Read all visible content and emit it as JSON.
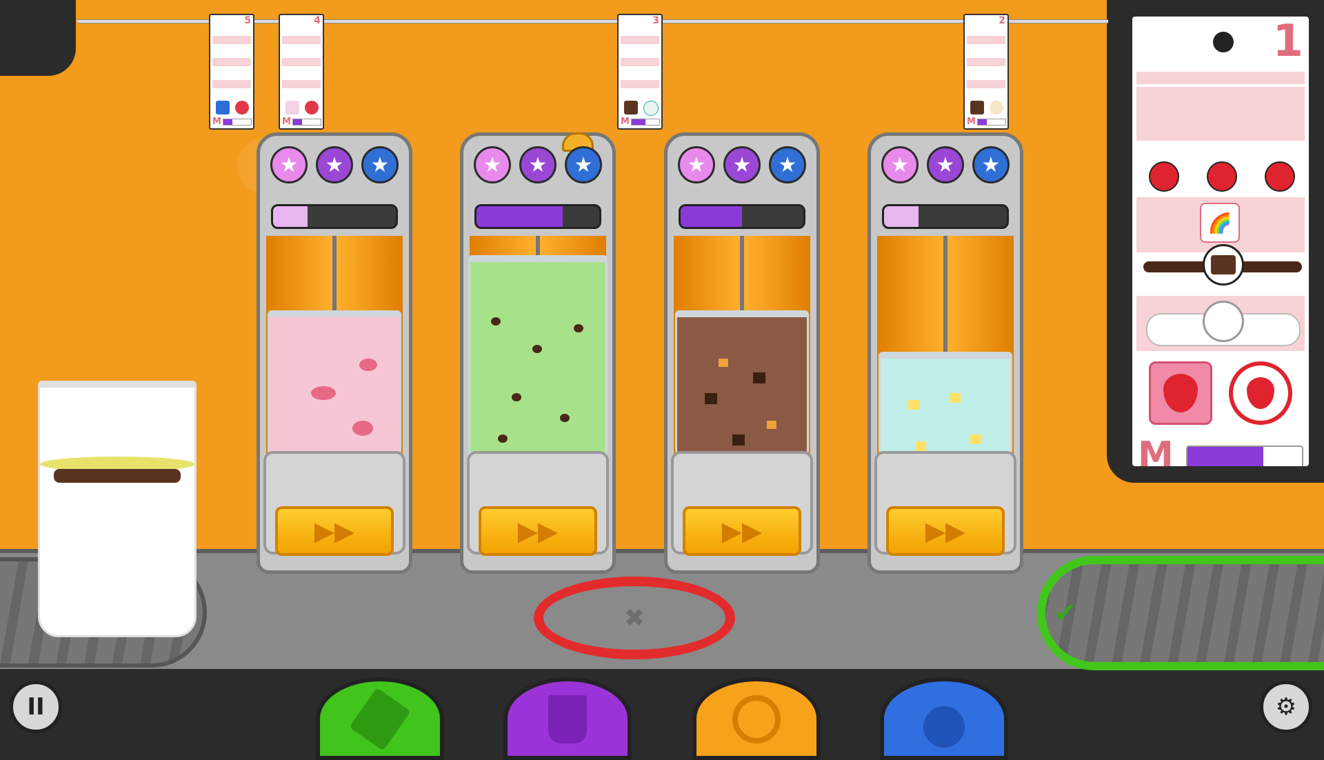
{
  "game": "blender-station",
  "colors": {
    "background": "#f39b1c",
    "counter": "#7f7f7f",
    "accept_green": "#42c61b",
    "reject_red": "#e22c2c",
    "star_pink": "#e889ec",
    "star_purple": "#9a47d6",
    "star_blue": "#2f6fd6"
  },
  "hanging_tickets": [
    {
      "number": "5",
      "size": "M",
      "size_level": 0.33
    },
    {
      "number": "4",
      "size": "M",
      "size_level": 0.33
    },
    {
      "number": "3",
      "size": "M",
      "size_level": 0.5
    },
    {
      "number": "2",
      "size": "M",
      "size_level": 0.33
    }
  ],
  "active_ticket": {
    "number": "1",
    "toppings": [
      "cherry-icon",
      "cherry-icon",
      "cherry-icon"
    ],
    "sprinkles": "rainbow-sprinkles-icon",
    "drizzle": "chocolate-drizzle-icon",
    "whipped": "whipped-cream-icon",
    "mixables": [
      "strawberry-icon",
      "strawberry-slice-icon"
    ],
    "size": "M",
    "size_level": 0.66
  },
  "blenders": [
    {
      "stars_lit": 0,
      "gauge_level": 0.28,
      "gauge_color": "#e7b6ef",
      "drink_color": "#f7c6d4",
      "mixin": "strawberry",
      "has_alarm": false
    },
    {
      "stars_lit": 3,
      "gauge_level": 0.7,
      "gauge_color": "#8a3ad8",
      "drink_color": "#a7e28a",
      "mixin": "cookie",
      "has_alarm": true
    },
    {
      "stars_lit": 0,
      "gauge_level": 0.5,
      "gauge_color": "#8a3ad8",
      "drink_color": "#8a5a44",
      "mixin": "brownie",
      "has_alarm": false
    },
    {
      "stars_lit": 0,
      "gauge_level": 0.28,
      "gauge_color": "#e7b6ef",
      "drink_color": "#bfeee8",
      "mixin": "pineapple",
      "has_alarm": false
    }
  ],
  "fast_forward_label": "▶▶",
  "bottom_tabs": [
    {
      "name": "order",
      "color": "#41c41c",
      "icon": "notepad-icon"
    },
    {
      "name": "build",
      "color": "#9b34d8",
      "icon": "cup-icon"
    },
    {
      "name": "mix",
      "color": "#f7a21b",
      "icon": "swirl-icon"
    },
    {
      "name": "top",
      "color": "#2f6fe0",
      "icon": "cherry-icon"
    }
  ],
  "pause_label": "II",
  "settings_label": "⚙",
  "trash_label": "✖",
  "accept_label": "✔"
}
